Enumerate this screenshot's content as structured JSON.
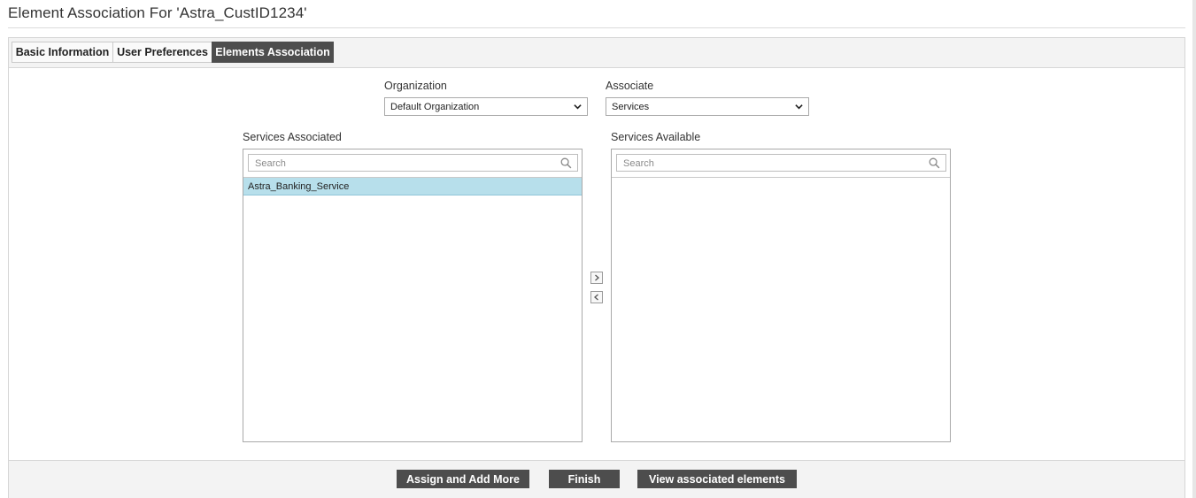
{
  "page": {
    "title": "Element Association For 'Astra_CustID1234'"
  },
  "tabs": [
    {
      "label": "Basic Information",
      "active": false
    },
    {
      "label": "User Preferences",
      "active": false
    },
    {
      "label": "Elements Association",
      "active": true
    }
  ],
  "organization": {
    "label": "Organization",
    "selected": "Default Organization"
  },
  "associate": {
    "label": "Associate",
    "selected": "Services"
  },
  "associated_list": {
    "label": "Services Associated",
    "search_placeholder": "Search",
    "items": [
      "Astra_Banking_Service"
    ]
  },
  "available_list": {
    "label": "Services Available",
    "search_placeholder": "Search",
    "items": []
  },
  "footer": {
    "assign_label": "Assign and Add More",
    "finish_label": "Finish",
    "view_label": "View associated elements"
  },
  "colors": {
    "tab_active_bg": "#4d4d4d",
    "selected_row_bg": "#b7dfeb",
    "button_bg": "#4d4d4d"
  }
}
